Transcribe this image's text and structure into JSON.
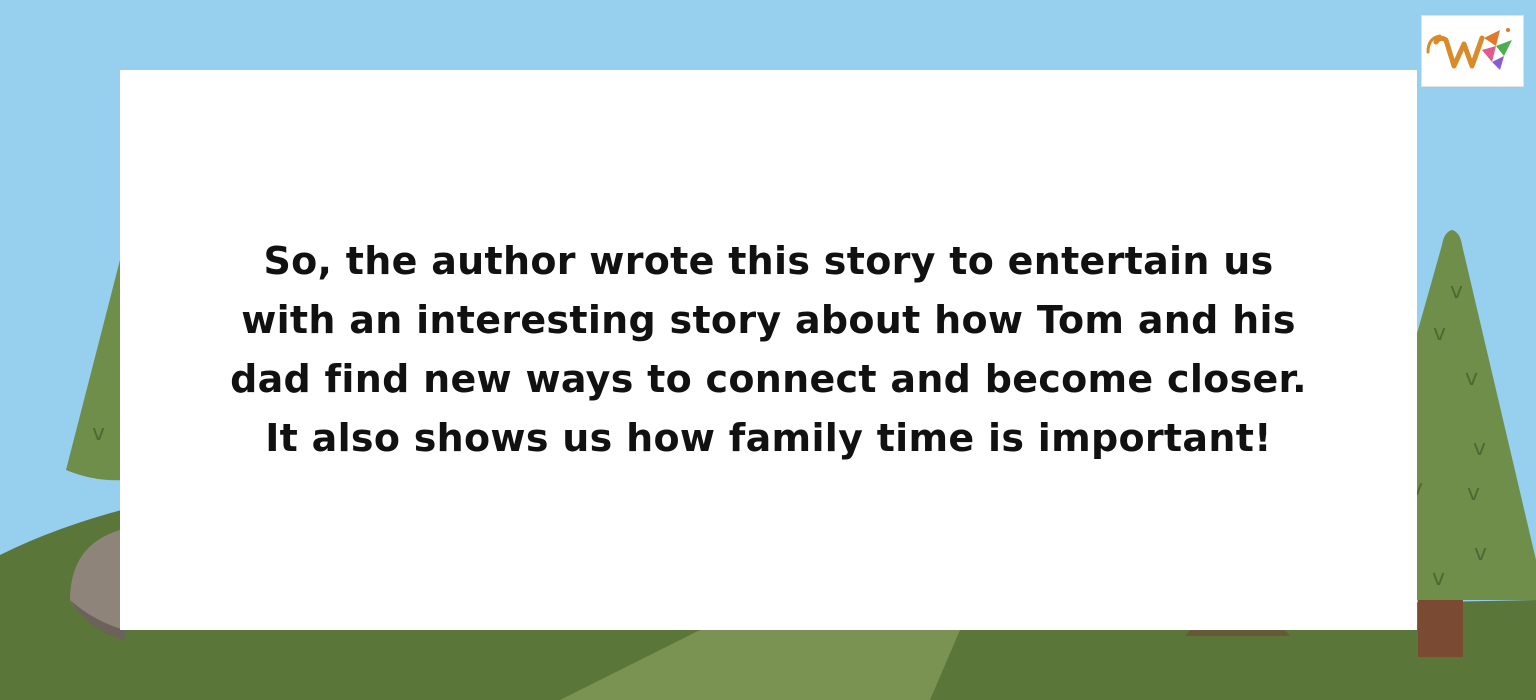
{
  "slide": {
    "text": "So, the author wrote this story to entertain us with an interesting story about how Tom and his dad find new ways to connect and become closer. It also shows us how family time is important!"
  },
  "logo": {
    "icon": "w-letter-logo-icon"
  },
  "colors": {
    "sky": "#97cfef",
    "hill_dark": "#5a7638",
    "hill_light": "#6d8c44",
    "path": "#7b9352",
    "tree_foliage": "#6e8e4a",
    "tree_trunk": "#7b4a33",
    "rock": "#8f847a",
    "card": "#ffffff"
  }
}
